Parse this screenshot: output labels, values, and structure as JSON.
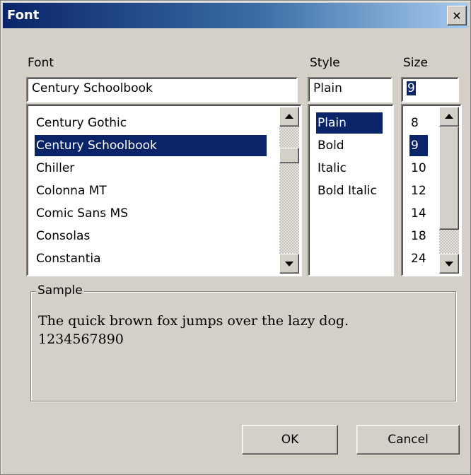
{
  "window": {
    "title": "Font",
    "close_glyph": "✕",
    "close_icon": "close-icon"
  },
  "labels": {
    "font": "Font",
    "style": "Style",
    "size": "Size"
  },
  "fields": {
    "font": "Century Schoolbook",
    "style": "Plain",
    "size": "9"
  },
  "font_list": {
    "items": [
      "Century Gothic",
      "Century Schoolbook",
      "Chiller",
      "Colonna MT",
      "Comic Sans MS",
      "Consolas",
      "Constantia"
    ],
    "selected": "Century Schoolbook"
  },
  "style_list": {
    "items": [
      "Plain",
      "Bold",
      "Italic",
      "Bold Italic"
    ],
    "selected": "Plain"
  },
  "size_list": {
    "items": [
      "8",
      "9",
      "10",
      "12",
      "14",
      "18",
      "24"
    ],
    "selected": "9"
  },
  "sample": {
    "legend": "Sample",
    "line1": "The quick brown fox jumps over the lazy dog.",
    "line2": "1234567890"
  },
  "buttons": {
    "ok": "OK",
    "cancel": "Cancel"
  },
  "colors": {
    "selection": "#0a246a",
    "face": "#d4d0c8",
    "title_start": "#0a246a",
    "title_end": "#a6caf0"
  }
}
